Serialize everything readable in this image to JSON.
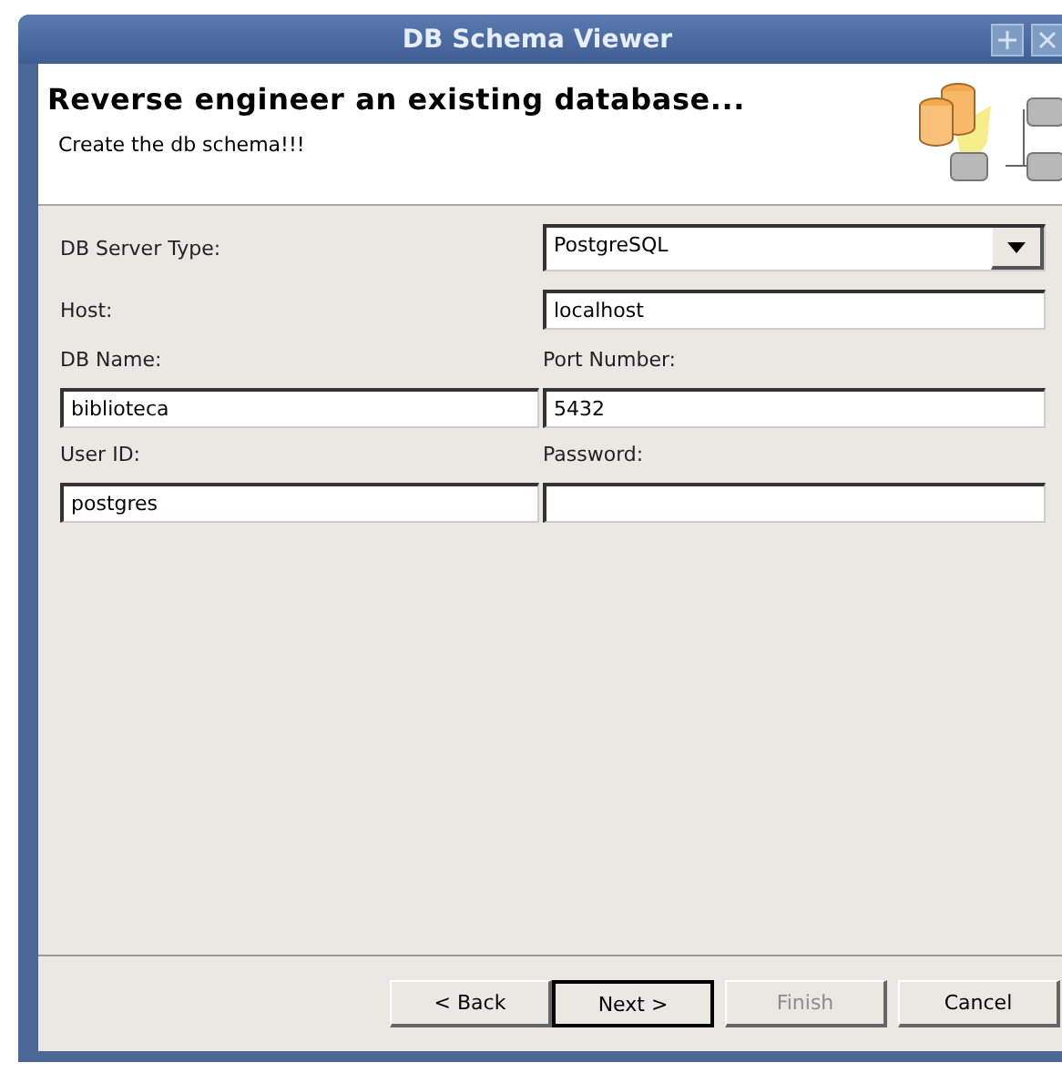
{
  "window": {
    "title": "DB Schema Viewer"
  },
  "header": {
    "title": "Reverse engineer an existing database...",
    "subtitle": "Create the db schema!!!"
  },
  "rows": [
    {
      "kind": "inline",
      "label": "DB Server Type:",
      "field": {
        "kind": "combo",
        "value": "PostgreSQL"
      }
    },
    {
      "kind": "inline",
      "label": "Host:",
      "field": {
        "kind": "text",
        "value": "localhost"
      }
    },
    {
      "kind": "pair",
      "cells": [
        {
          "label": "DB Name:",
          "field": {
            "kind": "text",
            "value": "biblioteca"
          }
        },
        {
          "label": "Port Number:",
          "field": {
            "kind": "text",
            "value": "5432"
          }
        }
      ]
    },
    {
      "kind": "pair",
      "cells": [
        {
          "label": "User ID:",
          "field": {
            "kind": "text",
            "value": "postgres"
          }
        },
        {
          "label": "Password:",
          "field": {
            "kind": "text"
          }
        }
      ]
    }
  ],
  "buttons": [
    {
      "label": "< Back",
      "disabled": false,
      "default": false
    },
    {
      "label": "Next >",
      "disabled": false,
      "default": true
    },
    {
      "label": "Finish",
      "disabled": true,
      "default": false
    },
    {
      "label": "Cancel",
      "disabled": false,
      "default": false
    }
  ]
}
